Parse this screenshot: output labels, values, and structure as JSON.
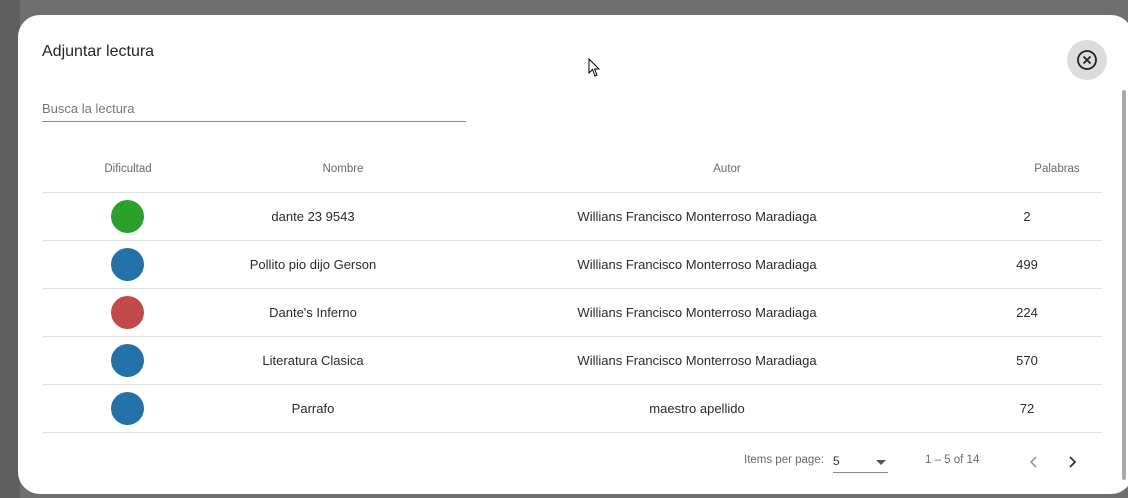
{
  "dialog": {
    "title": "Adjuntar lectura",
    "close_icon": "circle-x-icon"
  },
  "search": {
    "placeholder": "Busca la lectura",
    "value": ""
  },
  "table": {
    "headers": [
      "Dificultad",
      "Nombre",
      "Autor",
      "Palabras"
    ],
    "rows": [
      {
        "difficulty_color": "#2ba02b",
        "nombre": "dante 23 9543",
        "autor": "Willians Francisco Monterroso Maradiaga",
        "palabras": "2"
      },
      {
        "difficulty_color": "#2471a8",
        "nombre": "Pollito pio dijo Gerson",
        "autor": "Willians Francisco Monterroso Maradiaga",
        "palabras": "499"
      },
      {
        "difficulty_color": "#c24a4a",
        "nombre": "Dante's Inferno",
        "autor": "Willians Francisco Monterroso Maradiaga",
        "palabras": "224"
      },
      {
        "difficulty_color": "#2471a8",
        "nombre": "Literatura Clasica",
        "autor": "Willians Francisco Monterroso Maradiaga",
        "palabras": "570"
      },
      {
        "difficulty_color": "#2471a8",
        "nombre": "Parrafo",
        "autor": "maestro apellido",
        "palabras": "72"
      }
    ]
  },
  "paginator": {
    "items_per_page_label": "Items per page:",
    "items_per_page_value": "5",
    "range_label": "1 – 5 of 14",
    "prev_icon": "chevron-left-icon",
    "next_icon": "chevron-right-icon"
  },
  "colors": {
    "green": "#2ba02b",
    "blue": "#2471a8",
    "red": "#c24a4a"
  }
}
